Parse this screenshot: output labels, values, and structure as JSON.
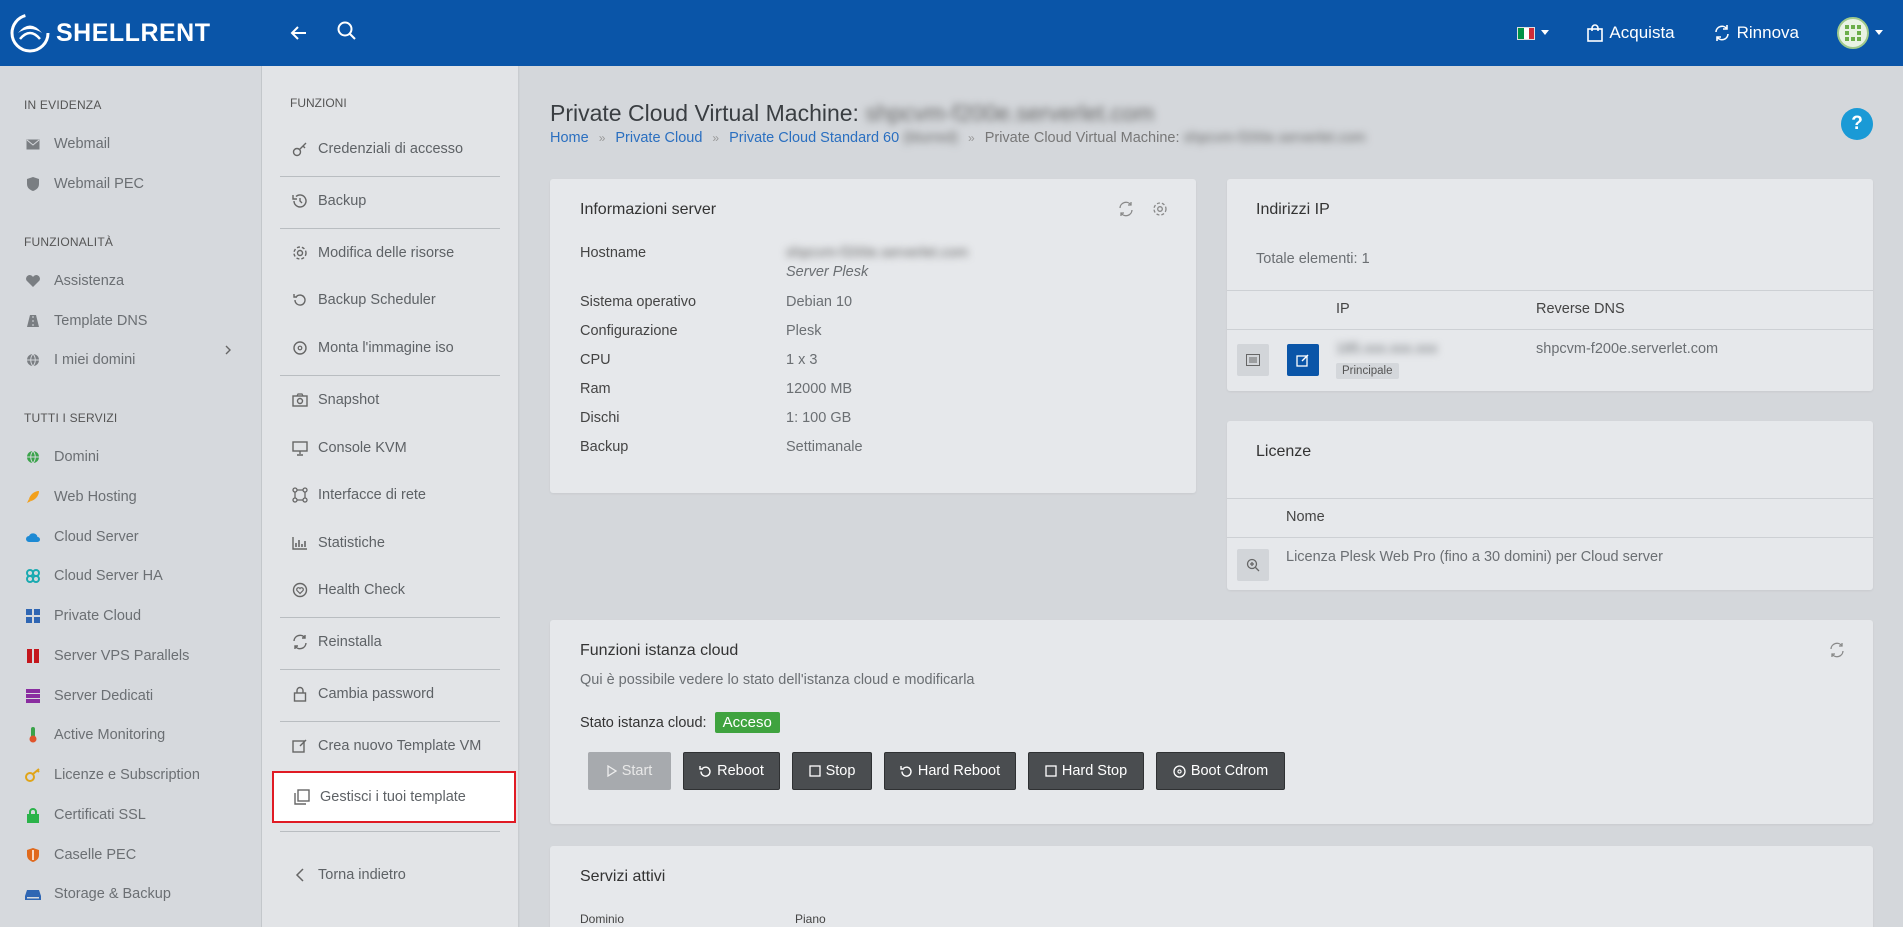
{
  "topbar": {
    "brand": "SHELLRENT",
    "buy_label": "Acquista",
    "renew_label": "Rinnova",
    "colors": {
      "bar": "#0a55a8"
    }
  },
  "sidebar": {
    "sections": [
      {
        "title": "IN EVIDENZA",
        "items": [
          {
            "label": "Webmail",
            "icon": "envelope-icon"
          },
          {
            "label": "Webmail PEC",
            "icon": "shield-icon"
          }
        ]
      },
      {
        "title": "FUNZIONALITÀ",
        "items": [
          {
            "label": "Assistenza",
            "icon": "heartbeat-icon"
          },
          {
            "label": "Template DNS",
            "icon": "road-icon"
          },
          {
            "label": "I miei domini",
            "icon": "globe-icon"
          }
        ]
      },
      {
        "title": "TUTTI I SERVIZI",
        "items": [
          {
            "label": "Domini",
            "icon": "globe-icon"
          },
          {
            "label": "Web Hosting",
            "icon": "rocket-icon"
          },
          {
            "label": "Cloud Server",
            "icon": "cloud-icon"
          },
          {
            "label": "Cloud Server HA",
            "icon": "ha-icon"
          },
          {
            "label": "Private Cloud",
            "icon": "windows-icon"
          },
          {
            "label": "Server VPS Parallels",
            "icon": "parallels-icon"
          },
          {
            "label": "Server Dedicati",
            "icon": "server-icon"
          },
          {
            "label": "Active Monitoring",
            "icon": "thermometer-icon"
          },
          {
            "label": "Licenze e Subscription",
            "icon": "key-icon"
          },
          {
            "label": "Certificati SSL",
            "icon": "lock-icon"
          },
          {
            "label": "Caselle PEC",
            "icon": "shield-icon"
          },
          {
            "label": "Storage & Backup",
            "icon": "storage-icon"
          }
        ]
      }
    ]
  },
  "functions": {
    "title": "FUNZIONI",
    "items": [
      {
        "label": "Credenziali di accesso",
        "icon": "key-icon"
      },
      {
        "label": "Backup",
        "icon": "history-icon"
      },
      {
        "label": "Modifica delle risorse",
        "icon": "gear-icon"
      },
      {
        "label": "Backup Scheduler",
        "icon": "undo-icon"
      },
      {
        "label": "Monta l'immagine iso",
        "icon": "disc-icon"
      },
      {
        "label": "Snapshot",
        "icon": "camera-icon"
      },
      {
        "label": "Console KVM",
        "icon": "monitor-icon"
      },
      {
        "label": "Interfacce di rete",
        "icon": "network-icon"
      },
      {
        "label": "Statistiche",
        "icon": "chart-icon"
      },
      {
        "label": "Health Check",
        "icon": "heart-icon"
      },
      {
        "label": "Reinstalla",
        "icon": "refresh-icon"
      },
      {
        "label": "Cambia password",
        "icon": "lock-icon"
      },
      {
        "label": "Crea nuovo Template VM",
        "icon": "edit-icon"
      },
      {
        "label": "Gestisci i tuoi template",
        "icon": "copy-icon"
      },
      {
        "label": "Torna indietro",
        "icon": "chevron-left-icon"
      }
    ]
  },
  "page": {
    "title": "Private Cloud Virtual Machine:",
    "title_hidden": "shpcvm-f200e.serverlet.com",
    "breadcrumb": {
      "home": "Home",
      "private_cloud": "Private Cloud",
      "standard": "Private Cloud Standard 60",
      "standard_hidden": "(blurred)",
      "current": "Private Cloud Virtual Machine:",
      "current_hidden": "shpcvm-f200e.serverlet.com"
    },
    "help": "?"
  },
  "server_info": {
    "title": "Informazioni server",
    "rows": [
      {
        "key": "Hostname",
        "value": "shpcvm-f200e.serverlet.com",
        "sub": "Server Plesk"
      },
      {
        "key": "Sistema operativo",
        "value": "Debian 10"
      },
      {
        "key": "Configurazione",
        "value": "Plesk"
      },
      {
        "key": "CPU",
        "value": "1 x 3"
      },
      {
        "key": "Ram",
        "value": "12000 MB"
      },
      {
        "key": "Dischi",
        "value": "1: 100 GB"
      },
      {
        "key": "Backup",
        "value": "Settimanale"
      }
    ]
  },
  "ip_card": {
    "title": "Indirizzi IP",
    "total": "Totale elementi: 1",
    "headers": [
      "IP",
      "Reverse DNS"
    ],
    "row": {
      "ip": "185.xxx.xxx.xxx",
      "tag": "Principale",
      "rdns": "shpcvm-f200e.serverlet.com"
    }
  },
  "licenses": {
    "title": "Licenze",
    "header": "Nome",
    "row": "Licenza Plesk Web Pro (fino a 30 domini) per Cloud server"
  },
  "cloud_functions": {
    "title": "Funzioni istanza cloud",
    "description": "Qui è possibile vedere lo stato dell'istanza cloud e modificarla",
    "status_label": "Stato istanza cloud:",
    "status_value": "Acceso",
    "buttons": [
      "Start",
      "Reboot",
      "Stop",
      "Hard Reboot",
      "Hard Stop",
      "Boot Cdrom"
    ]
  },
  "services": {
    "title": "Servizi attivi",
    "headers": [
      "Dominio",
      "Piano"
    ]
  }
}
